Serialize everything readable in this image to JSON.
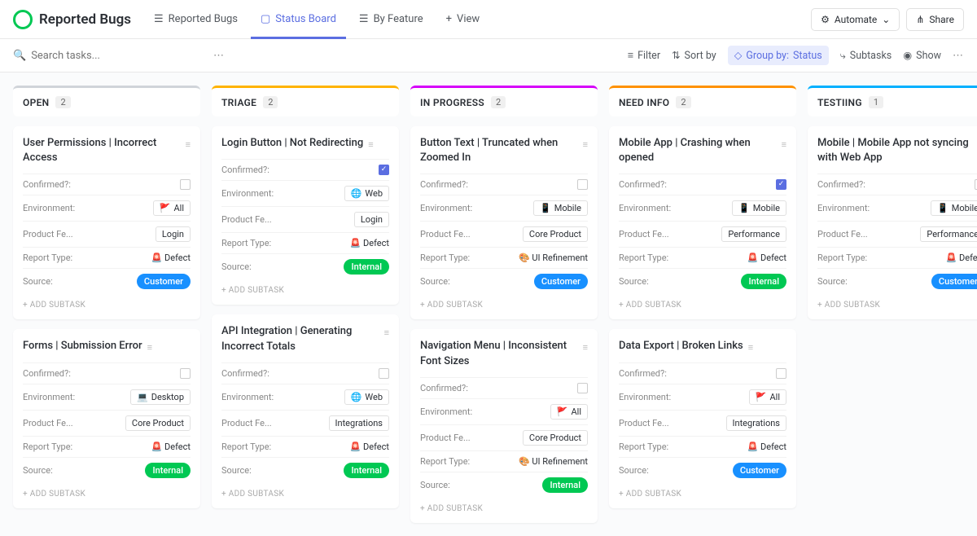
{
  "header": {
    "title": "Reported Bugs",
    "tabs": [
      {
        "label": "Reported Bugs"
      },
      {
        "label": "Status Board"
      },
      {
        "label": "By Feature"
      }
    ],
    "addView": "View",
    "automate": "Automate",
    "share": "Share"
  },
  "toolbar": {
    "searchPlaceholder": "Search tasks...",
    "filter": "Filter",
    "sortby": "Sort by",
    "groupby": "Group by:",
    "groupbyVal": "Status",
    "subtasks": "Subtasks",
    "show": "Show"
  },
  "addSubtask": "+ ADD SUBTASK",
  "labels": {
    "confirmed": "Confirmed?:",
    "environment": "Environment:",
    "productFe": "Product Fe...",
    "reportType": "Report Type:",
    "source": "Source:"
  },
  "columns": [
    {
      "title": "OPEN",
      "count": "2",
      "color": "#d0d4d9",
      "cards": [
        {
          "title": "User Permissions | Incorrect Access",
          "confirmed": false,
          "env": {
            "icon": "🚩",
            "label": "All"
          },
          "feature": "Login",
          "report": {
            "icon": "🚨",
            "label": "Defect"
          },
          "source": "Customer"
        },
        {
          "title": "Forms | Submission Error",
          "confirmed": false,
          "env": {
            "icon": "💻",
            "label": "Desktop"
          },
          "feature": "Core Product",
          "report": {
            "icon": "🚨",
            "label": "Defect"
          },
          "source": "Internal"
        }
      ]
    },
    {
      "title": "TRIAGE",
      "count": "2",
      "color": "#ffb300",
      "cards": [
        {
          "title": "Login Button | Not Redirecting",
          "confirmed": true,
          "env": {
            "icon": "🌐",
            "label": "Web"
          },
          "feature": "Login",
          "report": {
            "icon": "🚨",
            "label": "Defect"
          },
          "source": "Internal"
        },
        {
          "title": "API Integration | Generating Incorrect Totals",
          "confirmed": false,
          "env": {
            "icon": "🌐",
            "label": "Web"
          },
          "feature": "Integrations",
          "report": {
            "icon": "🚨",
            "label": "Defect"
          },
          "source": "Internal"
        }
      ]
    },
    {
      "title": "IN PROGRESS",
      "count": "2",
      "color": "#d500f9",
      "cards": [
        {
          "title": "Button Text | Truncated when Zoomed In",
          "confirmed": false,
          "env": {
            "icon": "📱",
            "label": "Mobile"
          },
          "feature": "Core Product",
          "report": {
            "icon": "🎨",
            "label": "UI Refinement"
          },
          "source": "Customer"
        },
        {
          "title": "Navigation Menu | Inconsistent Font Sizes",
          "confirmed": false,
          "env": {
            "icon": "🚩",
            "label": "All"
          },
          "feature": "Core Product",
          "report": {
            "icon": "🎨",
            "label": "UI Refinement"
          },
          "source": "Internal"
        }
      ]
    },
    {
      "title": "NEED INFO",
      "count": "2",
      "color": "#ff9100",
      "cards": [
        {
          "title": "Mobile App | Crashing when opened",
          "confirmed": true,
          "env": {
            "icon": "📱",
            "label": "Mobile"
          },
          "feature": "Performance",
          "report": {
            "icon": "🚨",
            "label": "Defect"
          },
          "source": "Internal"
        },
        {
          "title": "Data Export | Broken Links",
          "confirmed": false,
          "env": {
            "icon": "🚩",
            "label": "All"
          },
          "feature": "Integrations",
          "report": {
            "icon": "🚨",
            "label": "Defect"
          },
          "source": "Customer"
        }
      ]
    },
    {
      "title": "TESTIING",
      "count": "1",
      "color": "#00b0ff",
      "cards": [
        {
          "title": "Mobile | Mobile App not syncing with Web App",
          "confirmed": false,
          "env": {
            "icon": "📱",
            "label": "Mobile"
          },
          "feature": "Performance",
          "report": {
            "icon": "🚨",
            "label": "Defect"
          },
          "source": "Customer"
        }
      ]
    }
  ]
}
